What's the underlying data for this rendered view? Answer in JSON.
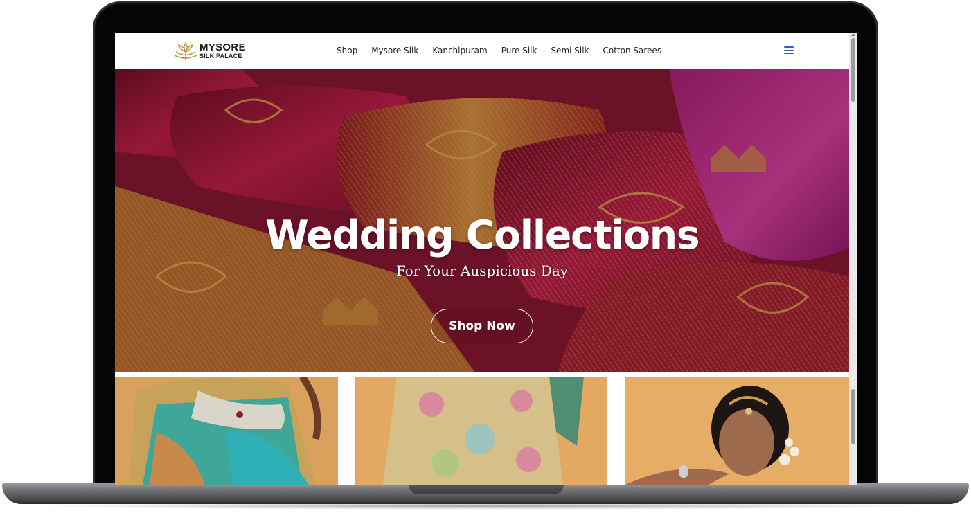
{
  "brand": {
    "line1": "MYSORE",
    "line2": "SILK PALACE"
  },
  "nav": {
    "items": [
      "Shop",
      "Mysore Silk",
      "Kanchipuram",
      "Pure Silk",
      "Semi Silk",
      "Cotton Sarees"
    ]
  },
  "icons": {
    "menu": "hamburger-menu-icon",
    "logo": "lotus-logo-icon"
  },
  "hero": {
    "title": "Wedding Collections",
    "subtitle": "For Your Auspicious Day",
    "cta_label": "Shop Now"
  },
  "products": [
    {
      "image": "teal-gold-silk-saree-with-waist-belt"
    },
    {
      "image": "pastel-floral-silk-saree-drape"
    },
    {
      "image": "bride-in-traditional-jewellery"
    }
  ],
  "colors": {
    "accent": "#2b63c7",
    "hero_crimson": "#9b1a3e",
    "hero_magenta": "#b0268a",
    "gold": "#c9a04a",
    "product_bg": "#e6a961"
  }
}
